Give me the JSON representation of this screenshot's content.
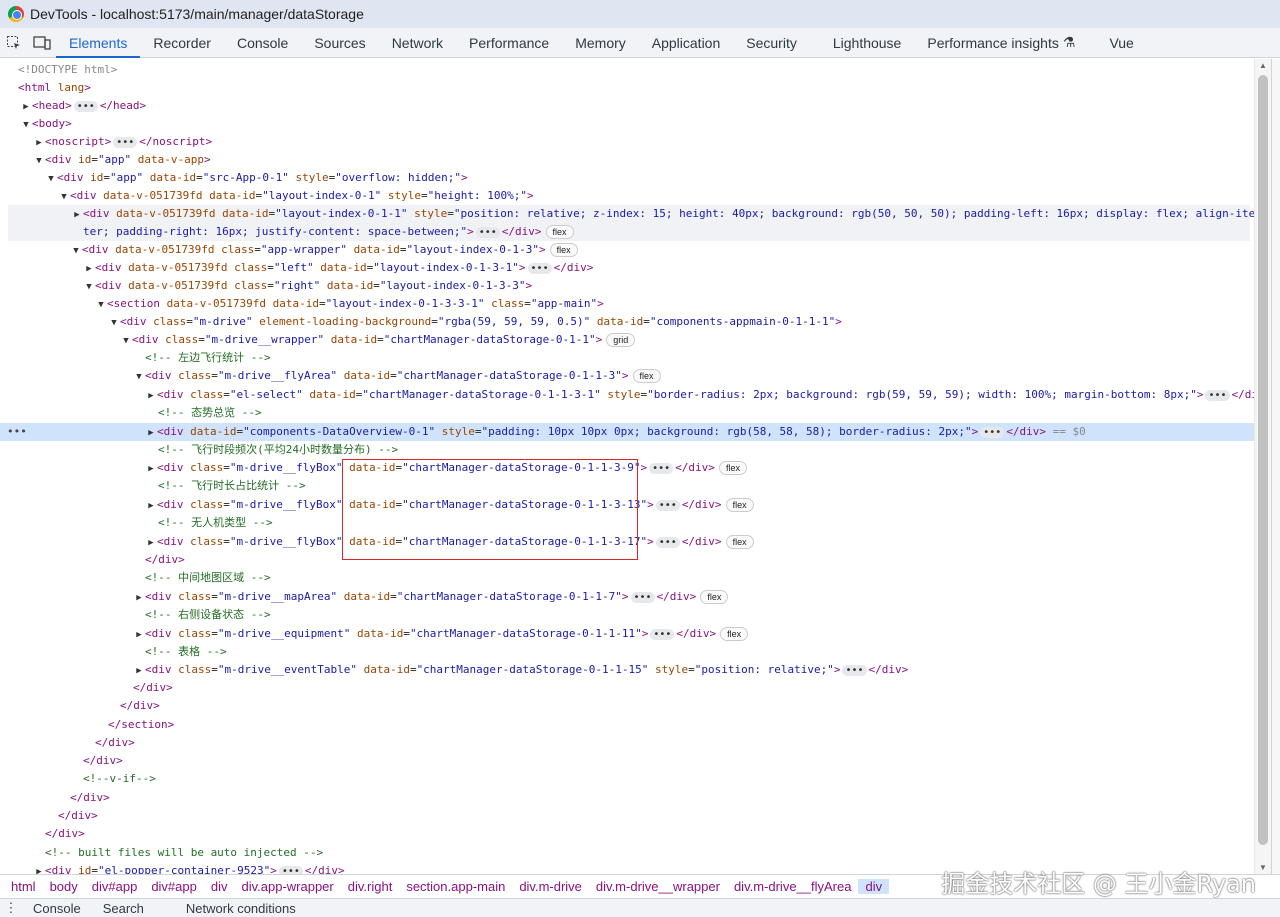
{
  "window": {
    "title": "DevTools - localhost:5173/main/manager/dataStorage"
  },
  "toolbar": {
    "inspect_icon": "inspect-icon",
    "device_icon": "device-toggle-icon"
  },
  "tabs": [
    {
      "label": "Elements"
    },
    {
      "label": "Recorder"
    },
    {
      "label": "Console"
    },
    {
      "label": "Sources"
    },
    {
      "label": "Network"
    },
    {
      "label": "Performance"
    },
    {
      "label": "Memory"
    },
    {
      "label": "Application"
    },
    {
      "label": "Security"
    },
    {
      "label": "Lighthouse"
    },
    {
      "label": "Performance insights"
    },
    {
      "label": "Vue"
    }
  ],
  "dom": {
    "selected_suffix": " == $0",
    "badges": {
      "flex": "flex",
      "grid": "grid"
    },
    "lines": [
      "<!DOCTYPE html>",
      "html",
      "head",
      "body",
      "noscript",
      "div id=\"app\" data-v-app",
      "div id=\"app\" data-id=\"src-App-0-1\" style=\"overflow: hidden;\"",
      "div data-v-051739fd data-id=\"layout-index-0-1\" style=\"height: 100%;\""
    ],
    "comments": {
      "left_stats": "<!-- 左边飞行统计 -->",
      "overview": "<!-- 态势总览 -->",
      "freq": "<!-- 飞行时段频次(平均24小时数量分布) -->",
      "duration": "<!-- 飞行时长占比统计 -->",
      "uav_type": "<!-- 无人机类型 -->",
      "map": "<!-- 中间地图区域 -->",
      "equipment": "<!-- 右侧设备状态 -->",
      "table": "<!-- 表格 -->",
      "vif": "<!--v-if-->",
      "built": "<!-- built files will be auto injected -->"
    }
  },
  "breadcrumb": [
    "html",
    "body",
    "div#app",
    "div#app",
    "div",
    "div.app-wrapper",
    "div.right",
    "section.app-main",
    "div.m-drive",
    "div.m-drive__wrapper",
    "div.m-drive__flyArea",
    "div"
  ],
  "watermark": "掘金技术社区 @ 王小金Ryan",
  "drawer": {
    "tabs": [
      {
        "label": "Console"
      },
      {
        "label": "Search"
      },
      {
        "label": "Network conditions"
      }
    ]
  }
}
